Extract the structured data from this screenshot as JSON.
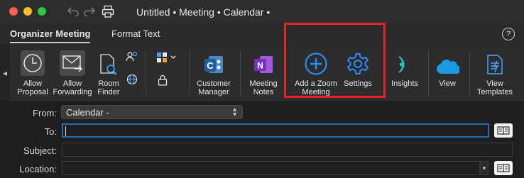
{
  "window": {
    "title": "Untitled • Meeting • Calendar •"
  },
  "tabs": [
    {
      "label": "Organizer Meeting",
      "active": true
    },
    {
      "label": "Format Text",
      "active": false
    }
  ],
  "help": {
    "label": "?"
  },
  "ribbon": {
    "scroll_left_glyph": "◀",
    "buttons": [
      {
        "label_line1": "Allow",
        "label_line2": "Proposal",
        "icon": "clock-icon",
        "active": true
      },
      {
        "label_line1": "Allow",
        "label_line2": "Forwarding",
        "icon": "mail-forward-icon",
        "active": true
      },
      {
        "label_line1": "Room",
        "label_line2": "Finder",
        "icon": "room-finder-icon",
        "active": false
      },
      {
        "label_line1": "Customer",
        "label_line2": "Manager",
        "icon": "customer-manager-icon",
        "active": false
      },
      {
        "label_line1": "Meeting",
        "label_line2": "Notes",
        "icon": "onenote-icon",
        "active": false
      },
      {
        "label_line1": "Add a Zoom",
        "label_line2": "Meeting",
        "icon": "zoom-add-icon",
        "active": false
      },
      {
        "label_line1": "Settings",
        "label_line2": "",
        "icon": "gear-icon",
        "active": false
      },
      {
        "label_line1": "Insights",
        "label_line2": "",
        "icon": "insights-icon",
        "active": false
      },
      {
        "label_line1": "View",
        "label_line2": "",
        "icon": "salesforce-cloud-icon",
        "active": false
      },
      {
        "label_line1": "View",
        "label_line2": "Templates",
        "icon": "templates-icon",
        "active": false
      }
    ]
  },
  "form": {
    "from": {
      "label": "From:",
      "value": "Calendar -"
    },
    "to": {
      "label": "To:",
      "value": ""
    },
    "subject": {
      "label": "Subject:",
      "value": ""
    },
    "location": {
      "label": "Location:",
      "value": ""
    }
  },
  "colors": {
    "accent_blue": "#2a8cff",
    "highlight_red": "#e42525",
    "onenote_purple": "#7b2fbf",
    "salesforce_blue": "#1b9bdf"
  }
}
